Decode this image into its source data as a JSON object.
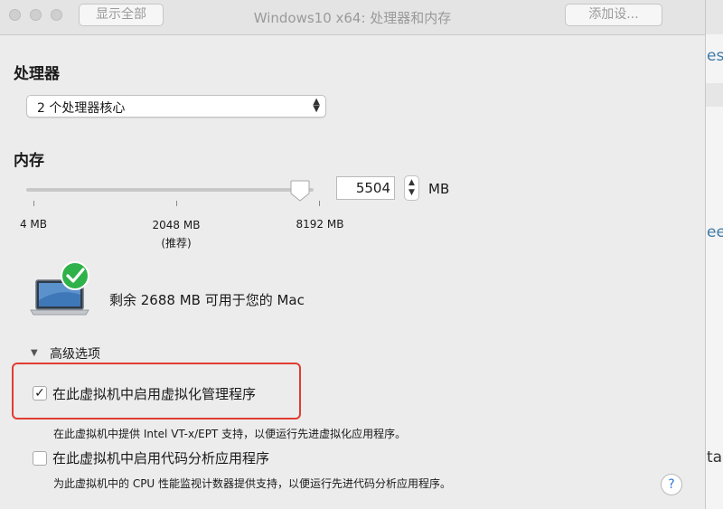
{
  "window": {
    "title": "Windows10 x64: 处理器和内存",
    "show_all_label": "显示全部",
    "add_device_label": "添加设..."
  },
  "processor": {
    "heading": "处理器",
    "selected": "2 个处理器核心"
  },
  "memory": {
    "heading": "内存",
    "value": "5504",
    "unit": "MB",
    "slider_value_mb": 5504,
    "ticks": {
      "min": "4 MB",
      "recommended": "2048 MB",
      "recommended_note": "(推荐)",
      "max": "8192 MB"
    },
    "available_text": "剩余 2688 MB 可用于您的 Mac"
  },
  "advanced": {
    "heading": "高级选项",
    "options": [
      {
        "label": "在此虚拟机中启用虚拟化管理程序",
        "checked": true,
        "description": "在此虚拟机中提供 Intel VT-x/EPT 支持，以便运行先进虚拟化应用程序。"
      },
      {
        "label": "在此虚拟机中启用代码分析应用程序",
        "checked": false,
        "description": "为此虚拟机中的 CPU 性能监视计数器提供支持，以便运行先进代码分析应用程序。"
      }
    ]
  },
  "help_label": "?",
  "right_pane": {
    "snippet_top": "es",
    "snippet_mid": "ee",
    "snippet_bottom": "ta"
  },
  "colors": {
    "highlight": "#e03c31",
    "check_badge": "#2fb24a"
  }
}
